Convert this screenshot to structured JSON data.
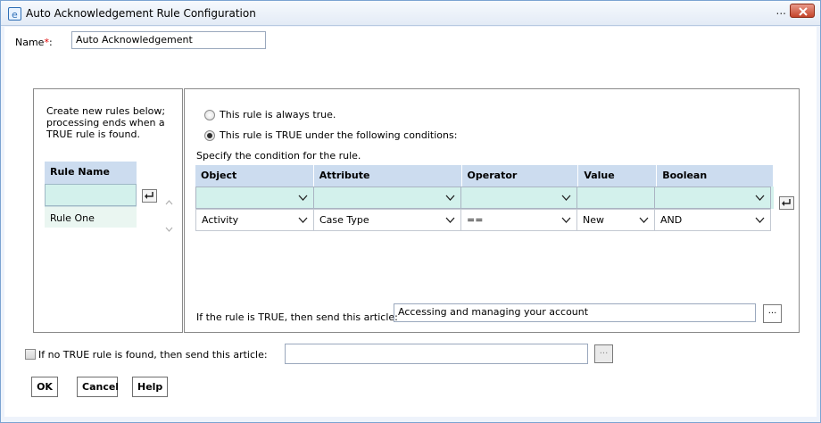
{
  "window": {
    "title": "Auto Acknowledgement Rule Configuration",
    "dots": "..."
  },
  "name": {
    "label": "Name",
    "required_mark": "*",
    "colon": ":",
    "value": "Auto Acknowledgement"
  },
  "left_panel": {
    "description": "Create new rules below; processing ends when a TRUE rule is found.",
    "column_header": "Rule Name",
    "new_rule_value": "",
    "rules": [
      "Rule One"
    ]
  },
  "conditions": {
    "radio_always_true": "This rule is always true.",
    "radio_following": "This rule is TRUE under the following conditions:",
    "selected": "following",
    "specify_label": "Specify the condition for the rule.",
    "columns": [
      "Object",
      "Attribute",
      "Operator",
      "Value",
      "Boolean"
    ],
    "new_row": [
      "",
      "",
      "",
      "",
      ""
    ],
    "rows": [
      [
        "Activity",
        "Case Type",
        "==",
        "New",
        "AND"
      ]
    ]
  },
  "send_article": {
    "label": "If the rule is TRUE, then send this article:",
    "value": "Accessing and managing your account",
    "button_label": "..."
  },
  "no_true": {
    "label": "If no TRUE rule is found, then send this article:",
    "value": "",
    "checked": false,
    "button_label": "..."
  },
  "buttons": {
    "ok": "OK",
    "cancel": "Cancel",
    "help": "Help"
  },
  "colors": {
    "header_blue": "#ccdcef",
    "new_row_teal": "#d3f1ec",
    "close_red": "#c4442a"
  }
}
